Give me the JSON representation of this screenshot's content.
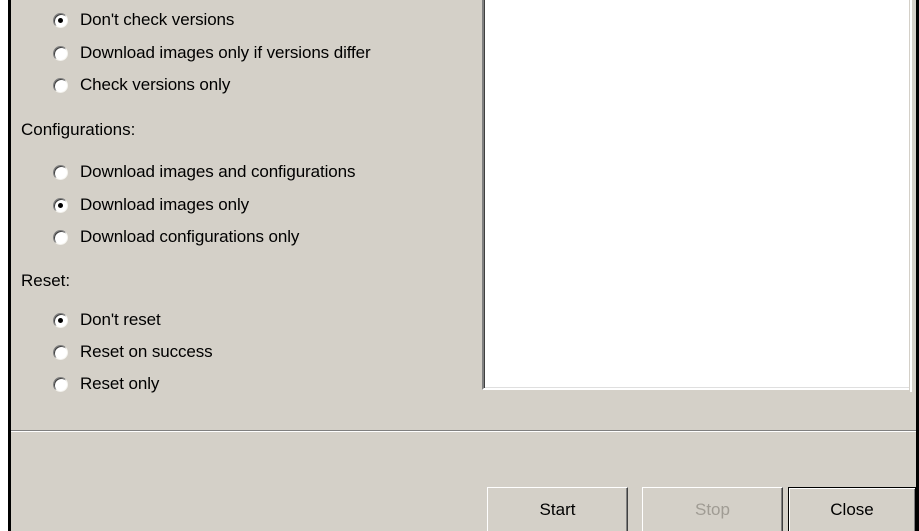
{
  "version_options": [
    {
      "label": "Don't check versions",
      "selected": true
    },
    {
      "label": "Download images only if versions differ",
      "selected": false
    },
    {
      "label": "Check versions only",
      "selected": false
    }
  ],
  "configurations": {
    "label": "Configurations:",
    "options": [
      {
        "label": "Download images and configurations",
        "selected": false
      },
      {
        "label": "Download images only",
        "selected": true
      },
      {
        "label": "Download configurations only",
        "selected": false
      }
    ]
  },
  "reset": {
    "label": "Reset:",
    "options": [
      {
        "label": "Don't reset",
        "selected": true
      },
      {
        "label": "Reset on success",
        "selected": false
      },
      {
        "label": "Reset only",
        "selected": false
      }
    ]
  },
  "buttons": {
    "start": "Start",
    "stop": "Stop",
    "close": "Close"
  },
  "colors": {
    "dialog_bg": "#d4d0c8",
    "disabled_text": "#a09c94"
  }
}
